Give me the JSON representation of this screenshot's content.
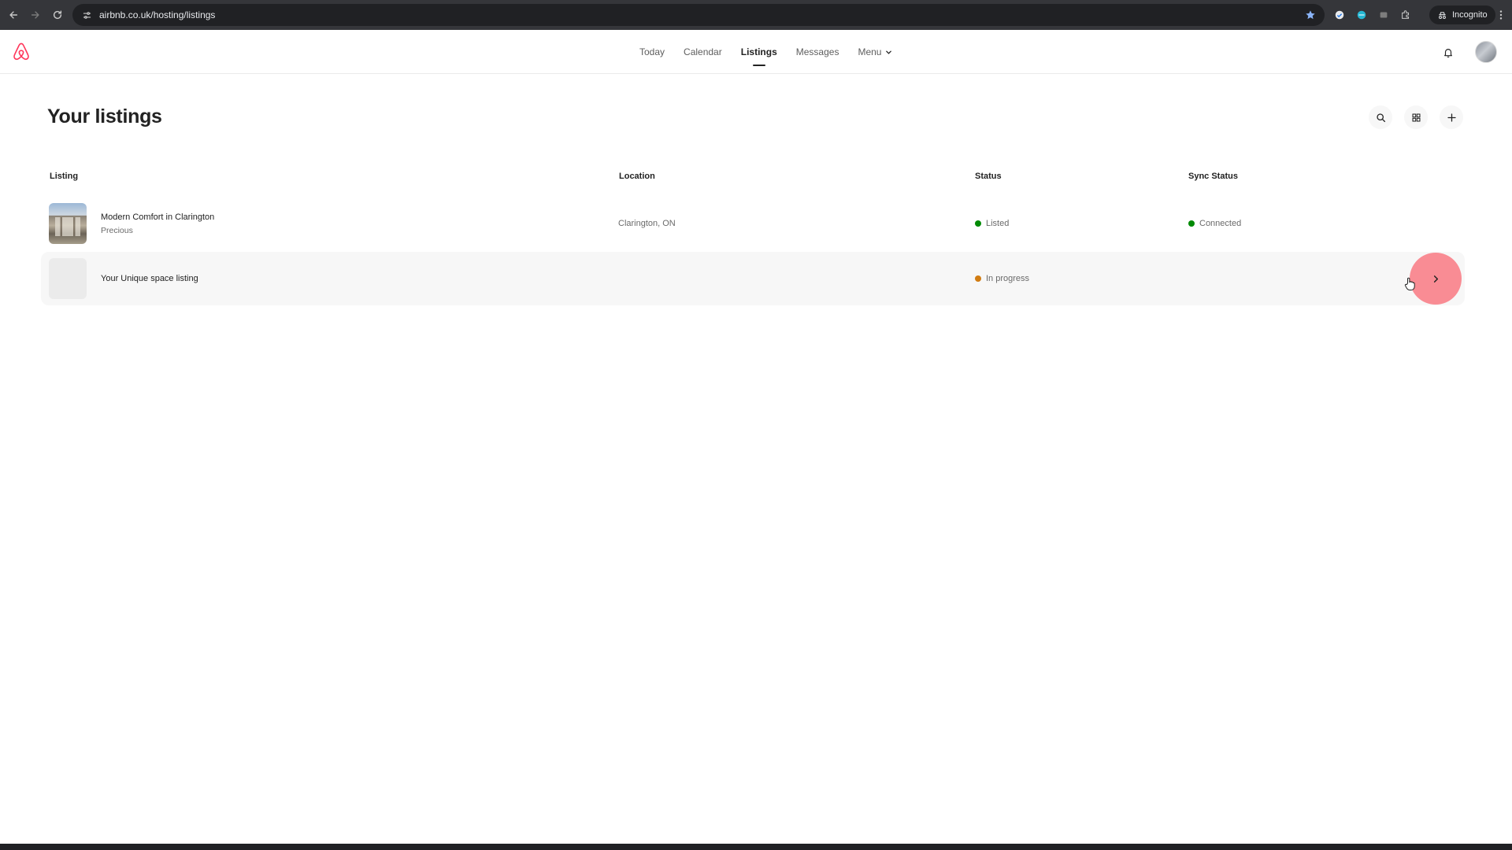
{
  "browser": {
    "url": "airbnb.co.uk/hosting/listings",
    "incognito_label": "Incognito"
  },
  "header": {
    "nav": [
      {
        "label": "Today"
      },
      {
        "label": "Calendar"
      },
      {
        "label": "Listings"
      },
      {
        "label": "Messages"
      },
      {
        "label": "Menu"
      }
    ],
    "active_nav": "Listings"
  },
  "page": {
    "title": "Your listings"
  },
  "table": {
    "columns": {
      "listing": "Listing",
      "location": "Location",
      "status": "Status",
      "sync_status": "Sync Status"
    },
    "rows": [
      {
        "title": "Modern Comfort in Clarington",
        "subtitle": "Precious",
        "location": "Clarington, ON",
        "status": "Listed",
        "status_color": "#008a05",
        "sync_status": "Connected",
        "sync_color": "#008a05"
      },
      {
        "title": "Your Unique space listing",
        "status": "In progress",
        "status_color": "#d17c12"
      }
    ]
  },
  "colors": {
    "brand": "#ff385c",
    "highlight": "#fa6e78"
  }
}
